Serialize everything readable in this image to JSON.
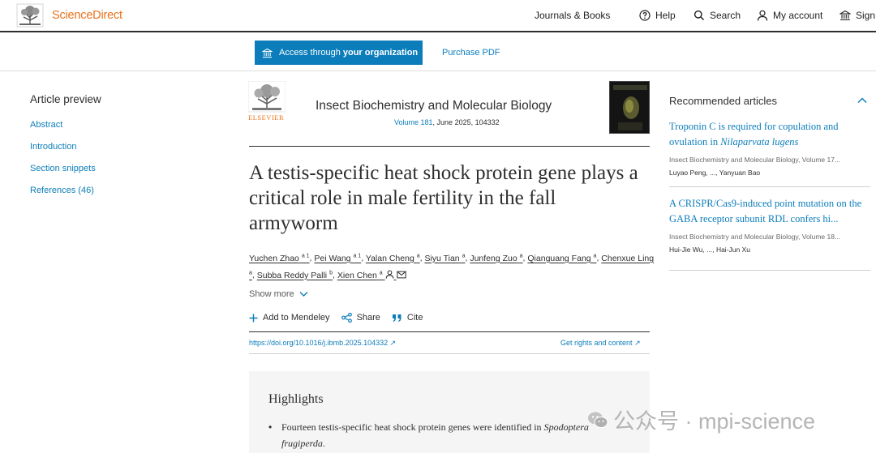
{
  "header": {
    "logo_text": "ScienceDirect",
    "nav": {
      "journals": "Journals & Books",
      "help": "Help",
      "search": "Search",
      "account": "My account",
      "sign_in": "Sign i"
    }
  },
  "access": {
    "button_prefix": "Access through ",
    "button_bold": "your organization",
    "purchase": "Purchase PDF"
  },
  "sidebar": {
    "title": "Article preview",
    "items": [
      {
        "label": "Abstract"
      },
      {
        "label": "Introduction"
      },
      {
        "label": "Section snippets"
      },
      {
        "label": "References (46)"
      }
    ]
  },
  "journal": {
    "publisher": "ELSEVIER",
    "title": "Insect Biochemistry and Molecular Biology",
    "volume": "Volume 181",
    "issue": ", June 2025, 104332"
  },
  "article": {
    "title": "A testis-specific heat shock protein gene plays a critical role in male fertility in the fall armyworm",
    "authors": [
      {
        "name": "Yuchen Zhao",
        "sup": "a 1"
      },
      {
        "name": "Pei Wang",
        "sup": "a 1"
      },
      {
        "name": "Yalan Cheng",
        "sup": "a"
      },
      {
        "name": "Siyu Tian",
        "sup": "a"
      },
      {
        "name": "Junfeng Zuo",
        "sup": "a"
      },
      {
        "name": "Qianguang Fang",
        "sup": "a"
      },
      {
        "name": "Chenxue Ling",
        "sup": "a"
      },
      {
        "name": "Subba Reddy Palli",
        "sup": "b"
      },
      {
        "name": "Xien Chen",
        "sup": "a"
      }
    ],
    "show_more": "Show more",
    "actions": {
      "mendeley": "Add to Mendeley",
      "share": "Share",
      "cite": "Cite"
    },
    "doi": "https://doi.org/10.1016/j.ibmb.2025.104332",
    "rights": "Get rights and content"
  },
  "highlights": {
    "title": "Highlights",
    "item_text": "Fourteen testis-specific heat shock protein genes were identified in ",
    "item_species": "Spodoptera frugiperda",
    "item_end": "."
  },
  "recommended": {
    "title": "Recommended articles",
    "items": [
      {
        "title_text": "Troponin C is required for copulation and ovulation in ",
        "title_species": "Nilaparvata lugens",
        "source": "Insect Biochemistry and Molecular Biology, Volume 17...",
        "authors": "Luyao Peng, ..., Yanyuan Bao"
      },
      {
        "title_text": "A CRISPR/Cas9-induced point mutation on the GABA receptor subunit RDL confers hi...",
        "source": "Insect Biochemistry and Molecular Biology, Volume 18...",
        "authors": "Hui-Jie Wu, ..., Hai-Jun Xu"
      }
    ]
  },
  "watermark": {
    "text": "公众号 · mpi-science"
  },
  "colors": {
    "brand_orange": "#e9711c",
    "link_blue": "#0c7dbb"
  }
}
